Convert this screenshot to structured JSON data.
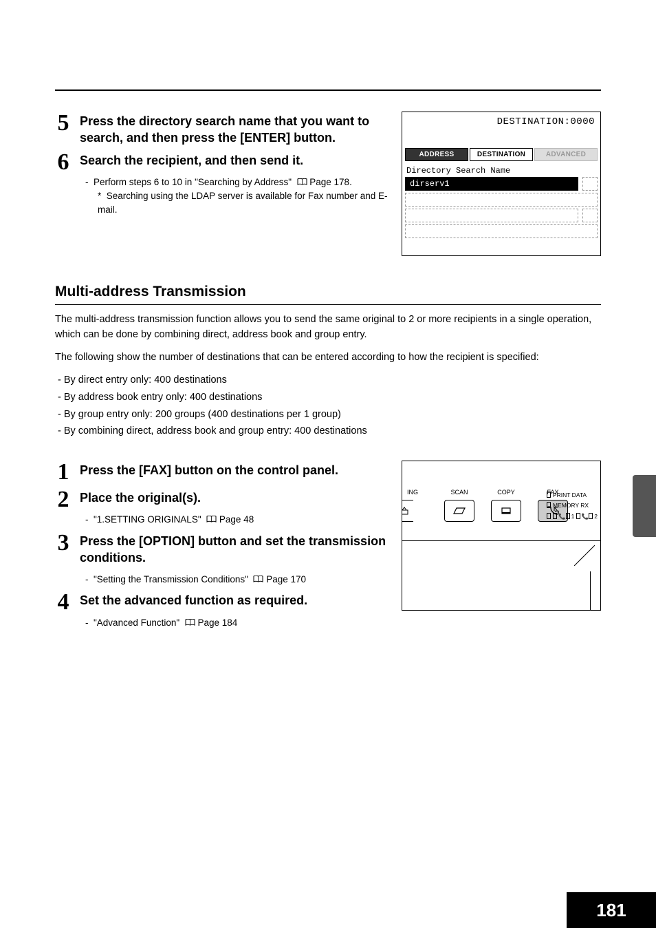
{
  "steps_a": [
    {
      "num": "5",
      "title": "Press the directory search name that you want to search, and then press the [ENTER] button."
    },
    {
      "num": "6",
      "title": "Search the recipient, and then send it.",
      "sub_dash": "Perform steps 6 to 10 in \"Searching by Address\"",
      "sub_page": "Page 178.",
      "sub_star": "Searching using the LDAP server is available for Fax number and E-mail."
    }
  ],
  "section_title": "Multi-address Transmission",
  "intro_p1": "The multi-address transmission function allows you to send the same original to 2 or more recipients in a single operation, which can be done by combining direct, address book and group entry.",
  "intro_p2": "The following show the number of destinations that can be entered according to how the recipient is specified:",
  "bullets": [
    "By direct entry only: 400 destinations",
    "By address book entry only: 400 destinations",
    "By group entry only: 200 groups (400 destinations per 1 group)",
    "By combining direct, address book and group entry: 400 destinations"
  ],
  "steps_b": [
    {
      "num": "1",
      "title": "Press the [FAX] button on the control panel."
    },
    {
      "num": "2",
      "title": "Place the original(s).",
      "sub_dash": "\"1.SETTING ORIGINALS\"",
      "sub_page": "Page 48"
    },
    {
      "num": "3",
      "title": "Press the [OPTION] button and set the transmission conditions.",
      "sub_dash": "\"Setting the Transmission Conditions\"",
      "sub_page": "Page 170"
    },
    {
      "num": "4",
      "title": "Set the advanced function as required.",
      "sub_dash": "\"Advanced Function\"",
      "sub_page": "Page 184"
    }
  ],
  "shot1": {
    "dest": "DESTINATION:0000",
    "tabs": [
      "ADDRESS",
      "DESTINATION",
      "ADVANCED"
    ],
    "label": "Directory Search Name",
    "row1": "dirserv1"
  },
  "shot2": {
    "buttons": [
      "ING",
      "SCAN",
      "COPY",
      "FAX"
    ],
    "leds": [
      "PRINT DATA",
      "MEMORY RX"
    ],
    "led_line": [
      "1",
      "2"
    ]
  },
  "page_number": "181"
}
